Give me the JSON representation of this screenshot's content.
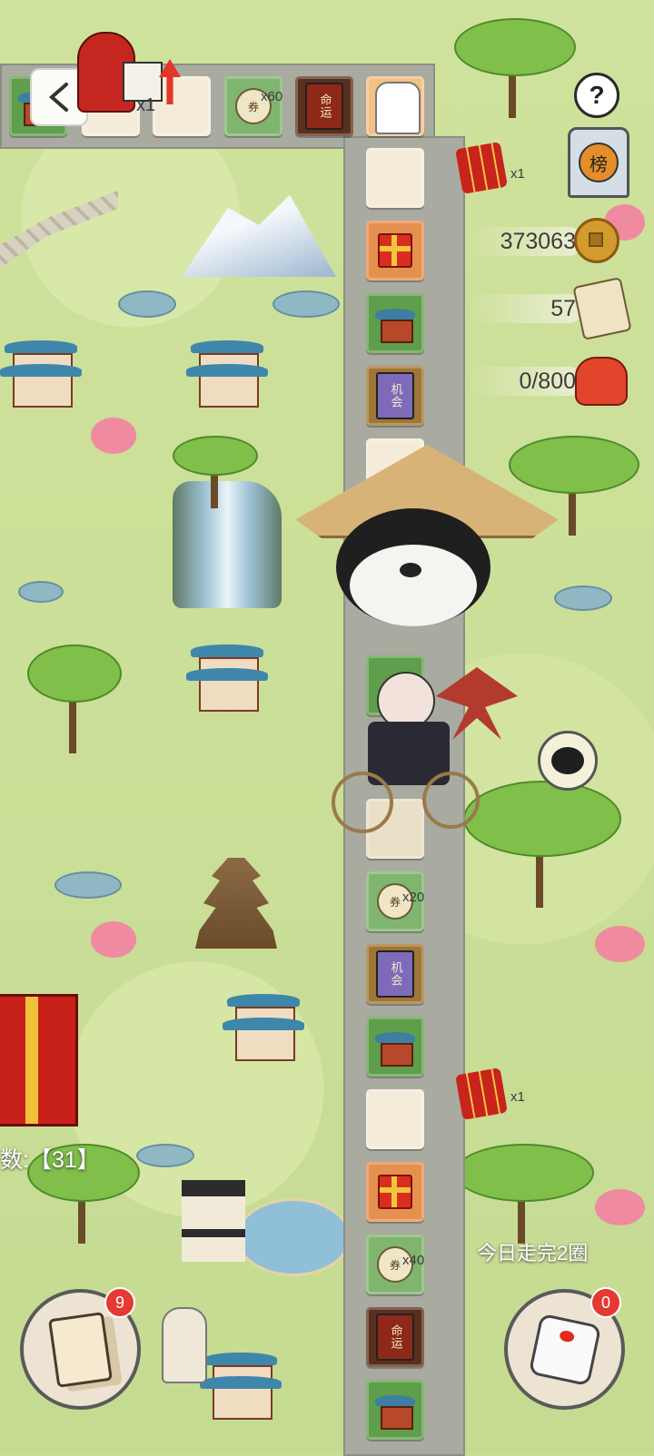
{
  "top_items": {
    "scroll_qty": "x60",
    "mul_label": "x1",
    "fate_book_label": "命运"
  },
  "right_panel": {
    "firecracker_qty_top": "x1",
    "rank_label": "榜",
    "coins": "373063",
    "tickets": "57",
    "gift_progress": "0/800",
    "help_label": "?"
  },
  "board": {
    "chance_label": "机会",
    "fate_label": "命运",
    "scroll_qty_20": "x20",
    "scroll_qty_40": "x40",
    "firecracker_qty_mid": "x1"
  },
  "bottom": {
    "steps_text": "数:【31】",
    "daily_text": "今日走完2圈",
    "cards_badge": "9",
    "dice_badge": "0"
  },
  "colors": {
    "badge_red": "#e33a34",
    "tile_orange": "#e6904f",
    "tile_green": "#5f9e4a",
    "tile_brown": "#a07634"
  },
  "icons": [
    "back-icon",
    "help-icon",
    "rank-icon",
    "coin-icon",
    "ticket-icon",
    "gift-bag-icon",
    "firecracker-icon",
    "cards-icon",
    "dice-icon",
    "panda-balloon",
    "player-character"
  ]
}
